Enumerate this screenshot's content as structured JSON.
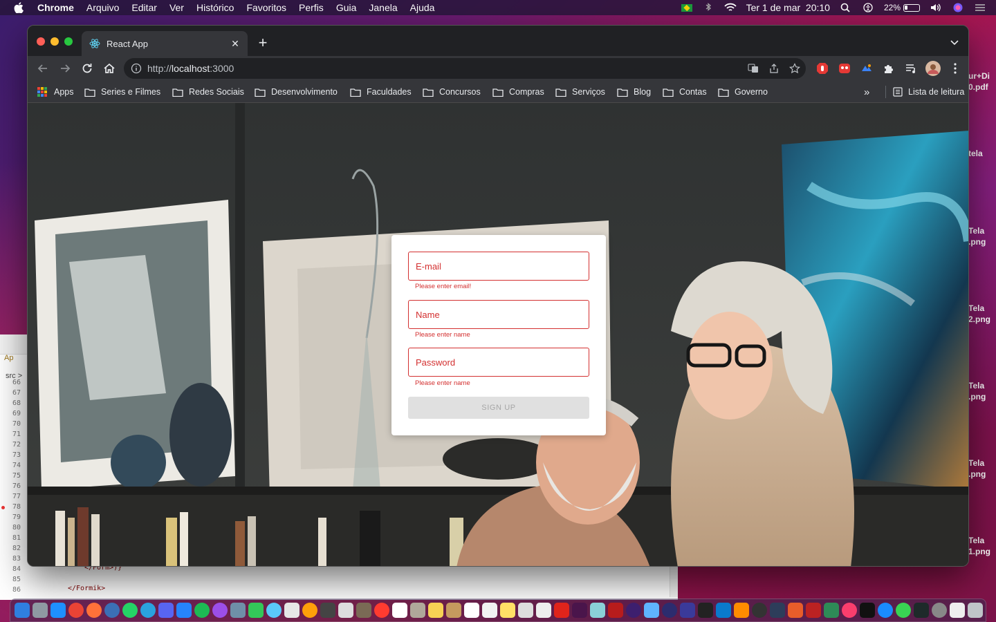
{
  "menubar": {
    "app_name": "Chrome",
    "items": [
      "Arquivo",
      "Editar",
      "Ver",
      "Histórico",
      "Favoritos",
      "Perfis",
      "Guia",
      "Janela",
      "Ajuda"
    ],
    "datetime": "Ter 1 de mar  20:10",
    "battery": "22%",
    "battery_level": 0.22
  },
  "desktop_files": [
    {
      "line1": "ur+Di",
      "line2": "0.pdf"
    },
    {
      "line1": "tela",
      "line2": ""
    },
    {
      "line1": "Tela",
      "line2": ".png"
    },
    {
      "line1": "Tela",
      "line2": "2.png"
    },
    {
      "line1": "Tela",
      "line2": ".png"
    },
    {
      "line1": "Tela",
      "line2": ".png"
    },
    {
      "line1": "Tela",
      "line2": "1.png"
    }
  ],
  "editor": {
    "tab_label": "Ap",
    "breadcrumb": "src >",
    "line_numbers": [
      "66",
      "67",
      "68",
      "69",
      "70",
      "71",
      "72",
      "73",
      "74",
      "75",
      "76",
      "77",
      "78",
      "79",
      "80",
      "81",
      "82",
      "83",
      "84",
      "85",
      "86"
    ],
    "code_lines": [
      "</Form>)}",
      "",
      "</Formik>"
    ]
  },
  "browser": {
    "tab_title": "React App",
    "url_scheme": "http://",
    "url_host": "localhost",
    "url_port": ":3000",
    "bookmarks": [
      {
        "label": "Apps",
        "kind": "apps"
      },
      {
        "label": "Series e Filmes",
        "kind": "folder"
      },
      {
        "label": "Redes Sociais",
        "kind": "folder"
      },
      {
        "label": "Desenvolvimento",
        "kind": "folder"
      },
      {
        "label": "Faculdades",
        "kind": "folder"
      },
      {
        "label": "Concursos",
        "kind": "folder"
      },
      {
        "label": "Compras",
        "kind": "folder"
      },
      {
        "label": "Serviços",
        "kind": "folder"
      },
      {
        "label": "Blog",
        "kind": "folder"
      },
      {
        "label": "Contas",
        "kind": "folder"
      },
      {
        "label": "Governo",
        "kind": "folder"
      }
    ],
    "overflow_label": "»",
    "reading_list": "Lista de leitura"
  },
  "form": {
    "email_label": "E-mail",
    "email_error": "Please enter email!",
    "name_label": "Name",
    "name_error": "Please enter name",
    "password_label": "Password",
    "password_error": "Please enter name",
    "submit_label": "SIGN UP",
    "error_color": "#d32f2f"
  },
  "icons": {
    "menubar_right": [
      "flag-br-icon",
      "bluetooth-icon",
      "wifi-icon",
      "search-icon",
      "accessibility-icon",
      "battery-icon",
      "volume-icon",
      "siri-icon",
      "control-center-icon"
    ],
    "toolbar_extensions": [
      "adblock-icon",
      "extension-red-icon",
      "extension-blue-icon",
      "puzzle-icon",
      "media-icon",
      "profile-avatar"
    ]
  }
}
